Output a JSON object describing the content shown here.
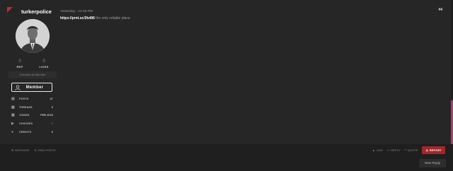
{
  "user": {
    "username": "turkerpolice",
    "reputation": "0",
    "reputation_label": "REP",
    "likes": "0",
    "likes_label": "LIKES",
    "checked_as": "Checked as Member",
    "badge": "Member",
    "stats": [
      {
        "icon": "comment-icon",
        "key": "POSTS",
        "value": "47"
      },
      {
        "icon": "list-icon",
        "key": "THREADS",
        "value": "0"
      },
      {
        "icon": "calendar-icon",
        "key": "JOINED",
        "value": "FEB 2023"
      },
      {
        "icon": "vouch-icon",
        "key": "VOUCHES",
        "value": "0"
      },
      {
        "icon": "credits-icon",
        "key": "CREDITS",
        "value": "0"
      }
    ]
  },
  "post": {
    "timestamp": "Yesterday - 12:45 PM",
    "number": "#4",
    "link": "https://prnt.sc/2tv8i6",
    "text": " the only reliable place"
  },
  "footer": {
    "message": "MESSAGE",
    "find_posts": "FIND POSTS",
    "like": "LIKE",
    "reply": "REPLY",
    "quote": "QUOTE",
    "report": "REPORT"
  },
  "new_reply": "New Reply",
  "colors": {
    "accent_red": "#a4262b",
    "accent_pink": "#b03a72",
    "background": "#1f1f1f",
    "panel": "#262626"
  }
}
